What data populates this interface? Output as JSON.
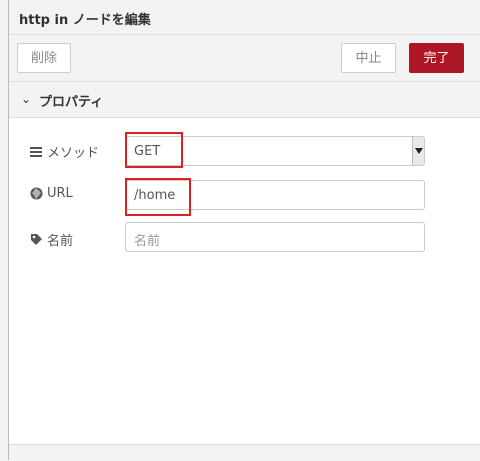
{
  "dialog": {
    "title": "http in ノードを編集"
  },
  "toolbar": {
    "delete_label": "削除",
    "cancel_label": "中止",
    "done_label": "完了"
  },
  "section": {
    "title": "プロパティ"
  },
  "form": {
    "method_label": "メソッド",
    "method_value": "GET",
    "url_label": "URL",
    "url_value": "/home",
    "name_label": "名前",
    "name_placeholder": "名前"
  },
  "icons": {
    "method": "list-icon",
    "url": "globe-icon",
    "name": "tag-icon",
    "section": "chevron-down-icon"
  },
  "colors": {
    "done": "#ad1625",
    "highlight": "#e02020"
  }
}
